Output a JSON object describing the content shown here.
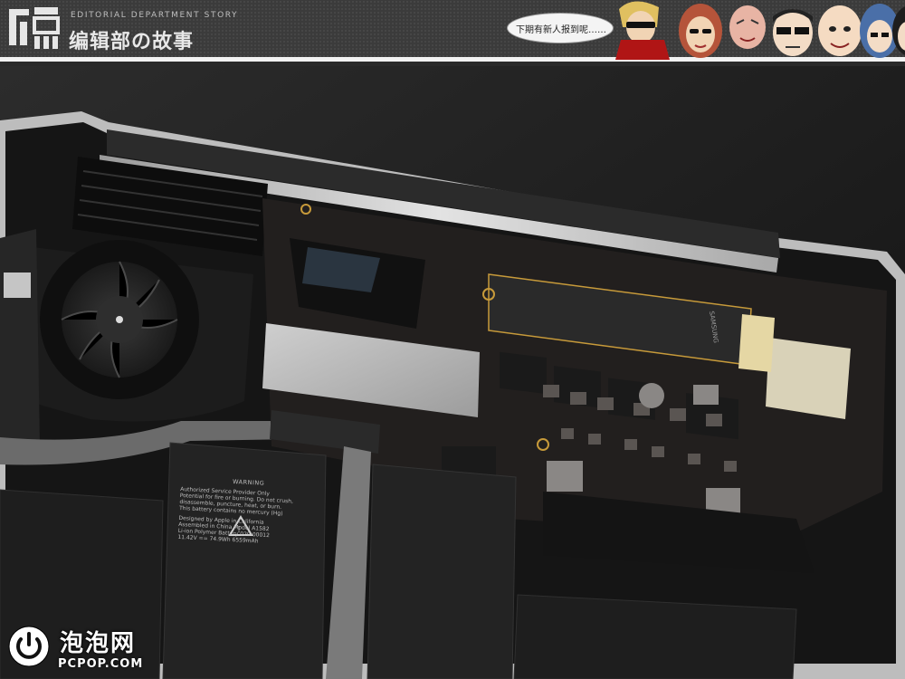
{
  "banner": {
    "tagline": "EDITORIAL DEPARTMENT STORY",
    "title": "编辑部の故事",
    "speech": "下期有新人报到呢……",
    "avatars": [
      "avatar-scarf-sunglasses",
      "avatar-red-hair",
      "avatar-bald",
      "avatar-glasses",
      "avatar-round-face",
      "avatar-blue-hair",
      "avatar-dark-hair"
    ]
  },
  "photo": {
    "subject": "laptop-logic-board-teardown",
    "battery_label": {
      "warning": "WARNING",
      "lines": [
        "Authorized Service Provider Only",
        "Potential for fire or burning. Do not crush,",
        "disassemble, puncture, heat, or burn.",
        "This battery contains no mercury (Hg)",
        "Designed by Apple in California",
        "Assembled in China  Model A1582",
        "Li-ion Polymer Battery  020-00012",
        "11.42V == 74.9Wh 6559mAh"
      ]
    },
    "ssd_brand": "SAMSUNG",
    "colors": {
      "board": "#221f1e",
      "chassis": "#c9c9c9",
      "gold": "#c79a3a"
    }
  },
  "watermark": {
    "name": "泡泡网",
    "domain": "PCPOP.COM"
  }
}
